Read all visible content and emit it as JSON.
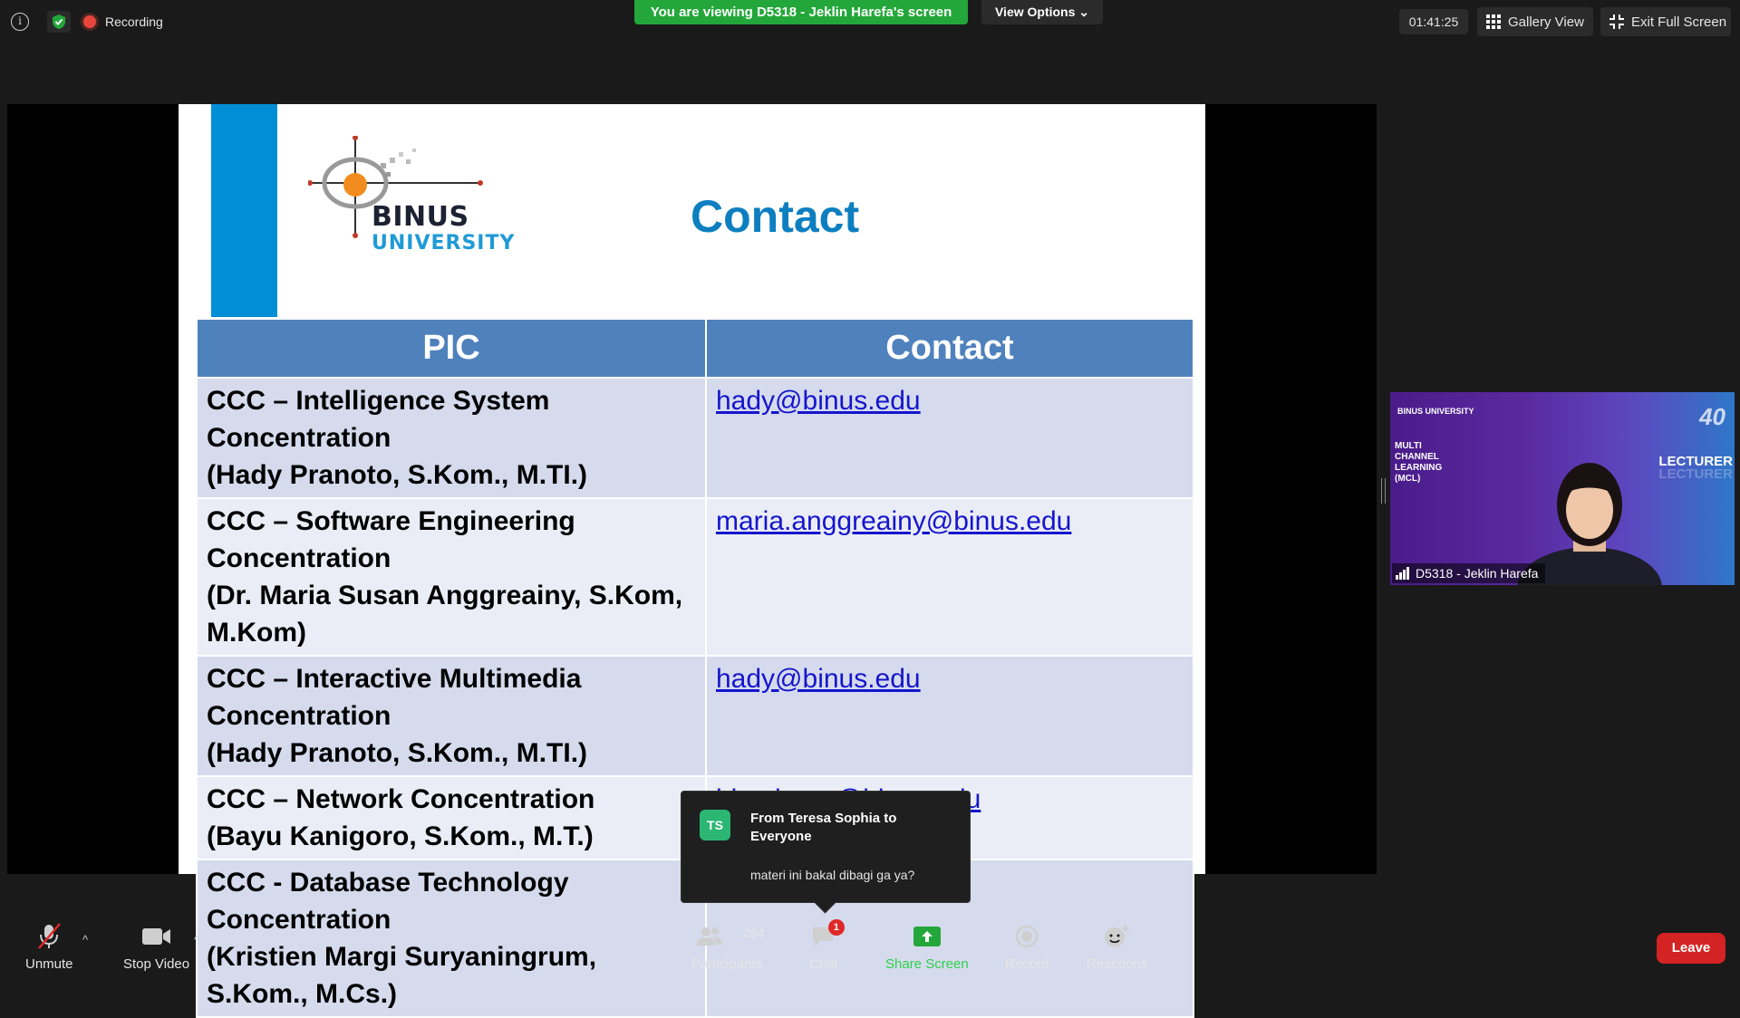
{
  "topbar": {
    "recording_label": "Recording",
    "viewing_banner": "You are viewing D5318 - Jeklin Harefa's screen",
    "view_options": "View Options",
    "timer": "01:41:25",
    "gallery_view": "Gallery View",
    "exit_full_screen": "Exit Full Screen"
  },
  "slide": {
    "logo_word": "BINUS",
    "logo_sub": "UNIVERSITY",
    "title": "Contact",
    "table": {
      "headers": [
        "PIC",
        "Contact"
      ],
      "rows": [
        {
          "line1": "CCC – Intelligence System Concentration",
          "line2": "(Hady Pranoto, S.Kom., M.TI.)",
          "email": "hady@binus.edu"
        },
        {
          "line1": "CCC – Software Engineering Concentration",
          "line2": "(Dr.  Maria Susan Anggreainy, S.Kom, M.Kom)",
          "email": "maria.anggreainy@binus.edu"
        },
        {
          "line1": "CCC – Interactive Multimedia Concentration",
          "line2": "(Hady Pranoto, S.Kom., M.TI.)",
          "email": "hady@binus.edu"
        },
        {
          "line1": "CCC – Network Concentration",
          "line2": "(Bayu Kanigoro, S.Kom., M.T.)",
          "email": "bkanigoro@binus.edu"
        },
        {
          "line1": "CCC - Database Technology Concentration",
          "line2": "(Kristien Margi Suryaningrum, S.Kom., M.Cs.)",
          "email": "kristien.s@binus.edu"
        }
      ]
    }
  },
  "chat_toast": {
    "initials": "TS",
    "from": "From Teresa Sophia to Everyone",
    "message": "materi ini bakal dibagi ga ya?"
  },
  "video_tile": {
    "logo_text": "BINUS UNIVERSITY",
    "mcl_text": "MULTI CHANNEL LEARNING (MCL)",
    "lecturer_text": "LECTURER",
    "number_text": "40",
    "participant_name": "D5318 - Jeklin Harefa"
  },
  "toolbar": {
    "unmute": "Unmute",
    "stop_video": "Stop Video",
    "participants": "Participants",
    "participant_count": "284",
    "chat": "Chat",
    "chat_badge": "1",
    "share_screen": "Share Screen",
    "record": "Record",
    "reactions": "Reactions",
    "leave": "Leave"
  },
  "colors": {
    "banner_green": "#23a73a",
    "slide_header_blue": "#4f81bd",
    "slide_title_blue": "#0d7fc0",
    "leave_red": "#d32323"
  }
}
